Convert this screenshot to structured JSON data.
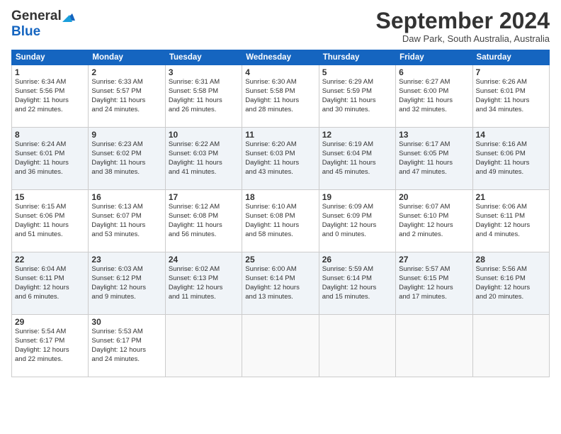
{
  "app": {
    "logo_general": "General",
    "logo_blue": "Blue",
    "title": "September 2024",
    "location": "Daw Park, South Australia, Australia"
  },
  "calendar": {
    "headers": [
      "Sunday",
      "Monday",
      "Tuesday",
      "Wednesday",
      "Thursday",
      "Friday",
      "Saturday"
    ],
    "weeks": [
      [
        {
          "num": "",
          "detail": ""
        },
        {
          "num": "2",
          "detail": "Sunrise: 6:33 AM\nSunset: 5:57 PM\nDaylight: 11 hours\nand 24 minutes."
        },
        {
          "num": "3",
          "detail": "Sunrise: 6:31 AM\nSunset: 5:58 PM\nDaylight: 11 hours\nand 26 minutes."
        },
        {
          "num": "4",
          "detail": "Sunrise: 6:30 AM\nSunset: 5:58 PM\nDaylight: 11 hours\nand 28 minutes."
        },
        {
          "num": "5",
          "detail": "Sunrise: 6:29 AM\nSunset: 5:59 PM\nDaylight: 11 hours\nand 30 minutes."
        },
        {
          "num": "6",
          "detail": "Sunrise: 6:27 AM\nSunset: 6:00 PM\nDaylight: 11 hours\nand 32 minutes."
        },
        {
          "num": "7",
          "detail": "Sunrise: 6:26 AM\nSunset: 6:01 PM\nDaylight: 11 hours\nand 34 minutes."
        }
      ],
      [
        {
          "num": "8",
          "detail": "Sunrise: 6:24 AM\nSunset: 6:01 PM\nDaylight: 11 hours\nand 36 minutes."
        },
        {
          "num": "9",
          "detail": "Sunrise: 6:23 AM\nSunset: 6:02 PM\nDaylight: 11 hours\nand 38 minutes."
        },
        {
          "num": "10",
          "detail": "Sunrise: 6:22 AM\nSunset: 6:03 PM\nDaylight: 11 hours\nand 41 minutes."
        },
        {
          "num": "11",
          "detail": "Sunrise: 6:20 AM\nSunset: 6:03 PM\nDaylight: 11 hours\nand 43 minutes."
        },
        {
          "num": "12",
          "detail": "Sunrise: 6:19 AM\nSunset: 6:04 PM\nDaylight: 11 hours\nand 45 minutes."
        },
        {
          "num": "13",
          "detail": "Sunrise: 6:17 AM\nSunset: 6:05 PM\nDaylight: 11 hours\nand 47 minutes."
        },
        {
          "num": "14",
          "detail": "Sunrise: 6:16 AM\nSunset: 6:06 PM\nDaylight: 11 hours\nand 49 minutes."
        }
      ],
      [
        {
          "num": "15",
          "detail": "Sunrise: 6:15 AM\nSunset: 6:06 PM\nDaylight: 11 hours\nand 51 minutes."
        },
        {
          "num": "16",
          "detail": "Sunrise: 6:13 AM\nSunset: 6:07 PM\nDaylight: 11 hours\nand 53 minutes."
        },
        {
          "num": "17",
          "detail": "Sunrise: 6:12 AM\nSunset: 6:08 PM\nDaylight: 11 hours\nand 56 minutes."
        },
        {
          "num": "18",
          "detail": "Sunrise: 6:10 AM\nSunset: 6:08 PM\nDaylight: 11 hours\nand 58 minutes."
        },
        {
          "num": "19",
          "detail": "Sunrise: 6:09 AM\nSunset: 6:09 PM\nDaylight: 12 hours\nand 0 minutes."
        },
        {
          "num": "20",
          "detail": "Sunrise: 6:07 AM\nSunset: 6:10 PM\nDaylight: 12 hours\nand 2 minutes."
        },
        {
          "num": "21",
          "detail": "Sunrise: 6:06 AM\nSunset: 6:11 PM\nDaylight: 12 hours\nand 4 minutes."
        }
      ],
      [
        {
          "num": "22",
          "detail": "Sunrise: 6:04 AM\nSunset: 6:11 PM\nDaylight: 12 hours\nand 6 minutes."
        },
        {
          "num": "23",
          "detail": "Sunrise: 6:03 AM\nSunset: 6:12 PM\nDaylight: 12 hours\nand 9 minutes."
        },
        {
          "num": "24",
          "detail": "Sunrise: 6:02 AM\nSunset: 6:13 PM\nDaylight: 12 hours\nand 11 minutes."
        },
        {
          "num": "25",
          "detail": "Sunrise: 6:00 AM\nSunset: 6:14 PM\nDaylight: 12 hours\nand 13 minutes."
        },
        {
          "num": "26",
          "detail": "Sunrise: 5:59 AM\nSunset: 6:14 PM\nDaylight: 12 hours\nand 15 minutes."
        },
        {
          "num": "27",
          "detail": "Sunrise: 5:57 AM\nSunset: 6:15 PM\nDaylight: 12 hours\nand 17 minutes."
        },
        {
          "num": "28",
          "detail": "Sunrise: 5:56 AM\nSunset: 6:16 PM\nDaylight: 12 hours\nand 20 minutes."
        }
      ],
      [
        {
          "num": "29",
          "detail": "Sunrise: 5:54 AM\nSunset: 6:17 PM\nDaylight: 12 hours\nand 22 minutes."
        },
        {
          "num": "30",
          "detail": "Sunrise: 5:53 AM\nSunset: 6:17 PM\nDaylight: 12 hours\nand 24 minutes."
        },
        {
          "num": "",
          "detail": ""
        },
        {
          "num": "",
          "detail": ""
        },
        {
          "num": "",
          "detail": ""
        },
        {
          "num": "",
          "detail": ""
        },
        {
          "num": "",
          "detail": ""
        }
      ]
    ],
    "week0_day1": {
      "num": "1",
      "detail": "Sunrise: 6:34 AM\nSunset: 5:56 PM\nDaylight: 11 hours\nand 22 minutes."
    }
  }
}
